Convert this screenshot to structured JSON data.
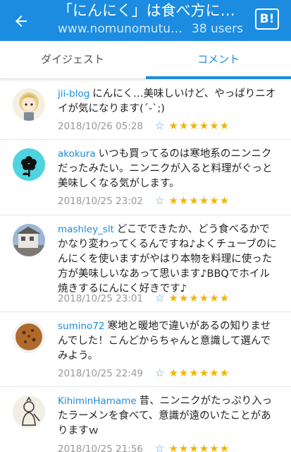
{
  "header": {
    "title": "「にんにく」は食べ方によ...",
    "url": "www.nomunomutuk...",
    "users": "38 users",
    "hatena_label": "B!"
  },
  "tabs": [
    {
      "label": "ダイジェスト",
      "active": false
    },
    {
      "label": "コメント",
      "active": true
    }
  ],
  "comments": [
    {
      "user": "jii-blog",
      "text": "にんにく…美味しいけど、やっぱりニオイが気になります(´-`;)",
      "date": "2018/10/26 05:28",
      "stars": "★★★★★★"
    },
    {
      "user": "akokura",
      "text": "いつも買ってるのは寒地系のニンニクだったみたい。ニンニクが入ると料理がぐっと美味しくなる気がします。",
      "date": "2018/10/25 23:02",
      "stars": "★★★★★★"
    },
    {
      "user": "mashley_slt",
      "text": "どこでできたか、どう食べるかでかなり変わってくるんですね♪よくチューブのにんにくを使いますがやはり本物を料理に使った方が美味しいなあって思います♪BBQでホイル焼きするにんにく好きです♪",
      "date": "2018/10/25 23:01",
      "stars": "★★★★★★"
    },
    {
      "user": "sumino72",
      "text": "寒地と暖地で違いがあるの知りませんでした！こんどからちゃんと意識して選んでみよう。",
      "date": "2018/10/25 22:49",
      "stars": "★★★★★★"
    },
    {
      "user": "KihiminHamame",
      "text": "昔、ニンニクがたっぷり入ったラーメンを食べて、意識が遠のいたことがありますｗ",
      "date": "2018/10/25 21:56",
      "stars": "★★★★★★"
    }
  ],
  "icons": {
    "back": "arrow-left-icon",
    "add_star": "add-star-icon",
    "accent": "#1b8ce0",
    "star_color": "#f0b400"
  }
}
